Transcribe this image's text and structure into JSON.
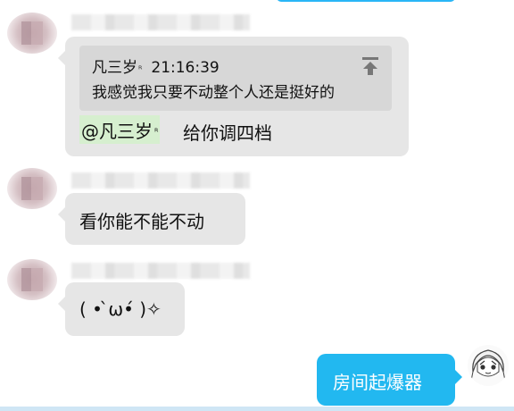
{
  "messages": [
    {
      "reply_quote": {
        "author": "凡三岁",
        "author_tag": "ᴿ",
        "time": "21:16:39",
        "text": "我感觉我只要不动整个人还是挺好的"
      },
      "mention": {
        "name": "@凡三岁",
        "tag": "ᴿ"
      },
      "text": "给你调四档"
    },
    {
      "text": "看你能不能不动"
    },
    {
      "text": "( • ̀ω•́ )✧"
    }
  ],
  "self_message": {
    "text": "房间起爆器"
  },
  "colors": {
    "incoming_bubble": "#e6e6e6",
    "quote_bg": "#d7d7d7",
    "mention_bg": "#d6efcf",
    "outgoing_bubble": "#22b8f0"
  }
}
